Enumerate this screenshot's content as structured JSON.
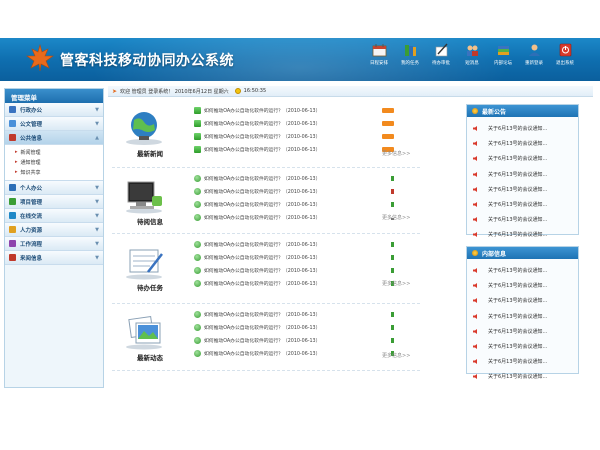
{
  "app": {
    "title": "管客科技移动协同办公系统"
  },
  "top_nav": [
    {
      "label": "日程安排",
      "icon": "calendar-icon"
    },
    {
      "label": "我的任务",
      "icon": "books-icon"
    },
    {
      "label": "待办审批",
      "icon": "pen-icon"
    },
    {
      "label": "短消息",
      "icon": "people-icon"
    },
    {
      "label": "内部论坛",
      "icon": "stack-icon"
    },
    {
      "label": "重新登录",
      "icon": "user-icon"
    },
    {
      "label": "退出系统",
      "icon": "exit-icon"
    }
  ],
  "sidebar": {
    "title": "管理菜单",
    "items": [
      {
        "label": "行政办公"
      },
      {
        "label": "公文管理"
      },
      {
        "label": "公共信息",
        "active": true,
        "children": [
          "新闻管理",
          "通知管理",
          "知识共享"
        ]
      },
      {
        "label": "个人办公"
      },
      {
        "label": "项目管理"
      },
      {
        "label": "在线交流"
      },
      {
        "label": "人力资源"
      },
      {
        "label": "工作流程"
      },
      {
        "label": "来阅信息"
      }
    ]
  },
  "welcome": {
    "text": "欢迎 管理员 登录系统！ 2010年6月12日 星期六",
    "time": "16:50:35"
  },
  "sections": [
    {
      "title": "最新新闻",
      "more": "更多信息>>",
      "rows": [
        "如何推动OA办公自动化软件的运行？（2010-06-13）",
        "如何推动OA办公自动化软件的运行？（2010-06-13）",
        "如何推动OA办公自动化软件的运行？（2010-06-13）",
        "如何推动OA办公自动化软件的运行？（2010-06-13）"
      ]
    },
    {
      "title": "待阅信息",
      "more": "更多信息>>",
      "rows": [
        "如何推动OA办公自动化软件的运行？（2010-06-13）",
        "如何推动OA办公自动化软件的运行？（2010-06-13）",
        "如何推动OA办公自动化软件的运行？（2010-06-13）",
        "如何推动OA办公自动化软件的运行？（2010-06-13）"
      ]
    },
    {
      "title": "待办任务",
      "more": "更多信息>>",
      "rows": [
        "如何推动OA办公自动化软件的运行？（2010-06-13）",
        "如何推动OA办公自动化软件的运行？（2010-06-13）",
        "如何推动OA办公自动化软件的运行？（2010-06-13）",
        "如何推动OA办公自动化软件的运行？（2010-06-13）"
      ]
    },
    {
      "title": "最新动态",
      "more": "更多信息>>",
      "rows": [
        "如何推动OA办公自动化软件的运行？（2010-06-13）",
        "如何推动OA办公自动化软件的运行？（2010-06-13）",
        "如何推动OA办公自动化软件的运行？（2010-06-13）",
        "如何推动OA办公自动化软件的运行？（2010-06-13）"
      ]
    }
  ],
  "panels": [
    {
      "title": "最新公告",
      "items": [
        "关于6月13号的会议通知...",
        "关于6月13号的会议通知...",
        "关于6月13号的会议通知...",
        "关于6月13号的会议通知...",
        "关于6月13号的会议通知...",
        "关于6月13号的会议通知...",
        "关于6月13号的会议通知...",
        "关于6月13号的会议通知..."
      ]
    },
    {
      "title": "内部信息",
      "items": [
        "关于6月13号的会议通知...",
        "关于6月13号的会议通知...",
        "关于6月13号的会议通知...",
        "关于6月13号的会议通知...",
        "关于6月13号的会议通知...",
        "关于6月13号的会议通知...",
        "关于6月13号的会议通知...",
        "关于6月13号的会议通知..."
      ]
    }
  ],
  "colors": {
    "header": "#1c88c8",
    "accent": "#f28a1e",
    "panel_head": "#1e73b4"
  }
}
